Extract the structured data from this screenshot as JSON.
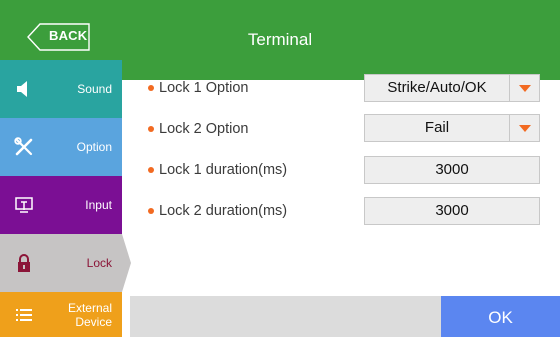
{
  "header": {
    "title": "Terminal",
    "back_label": "BACK",
    "color": "#3c9e3c"
  },
  "sidebar": {
    "items": [
      {
        "label": "Sound",
        "icon": "speaker-icon",
        "color": "#29a4a0"
      },
      {
        "label": "Option",
        "icon": "tools-icon",
        "color": "#5aa4de"
      },
      {
        "label": "Input",
        "icon": "monitor-input-icon",
        "color": "#7b0f94"
      },
      {
        "label": "Lock",
        "icon": "lock-icon",
        "color": "#c6c4c4",
        "selected": true
      },
      {
        "label": "External Device",
        "label_line1": "External",
        "label_line2": "Device",
        "icon": "list-icon",
        "color": "#efa01b"
      }
    ]
  },
  "settings": [
    {
      "label": "Lock 1 Option",
      "value": "Strike/Auto/OK",
      "type": "dropdown"
    },
    {
      "label": "Lock 2 Option",
      "value": "Fail",
      "type": "dropdown"
    },
    {
      "label": "Lock 1 duration(ms)",
      "value": "3000",
      "type": "number"
    },
    {
      "label": "Lock 2 duration(ms)",
      "value": "3000",
      "type": "number"
    }
  ],
  "footer": {
    "ok_label": "OK",
    "ok_color": "#5b86f0"
  },
  "accent": "#f26a21"
}
